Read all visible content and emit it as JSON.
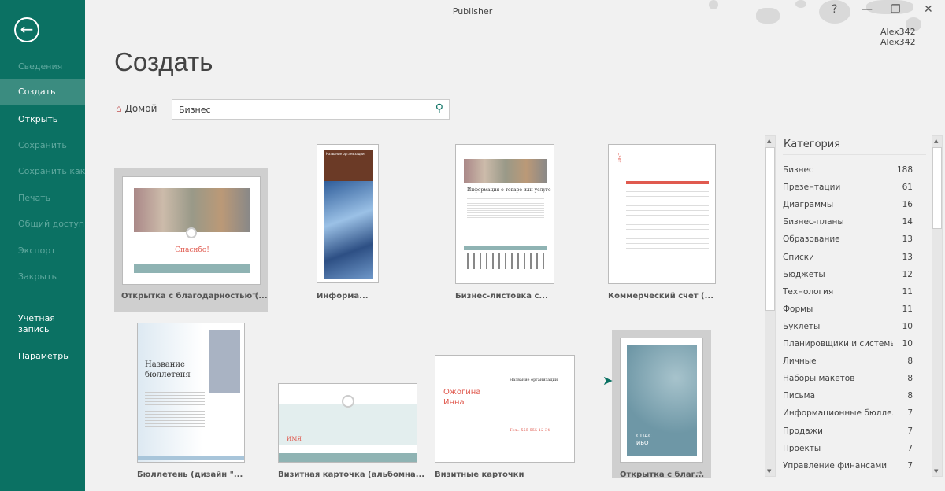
{
  "app": {
    "title": "Publisher",
    "help": "?",
    "user": "Alex342 Alex342"
  },
  "sidebar": {
    "items": [
      {
        "label": "Сведения",
        "enabled": false
      },
      {
        "label": "Создать",
        "enabled": true,
        "selected": true
      },
      {
        "label": "Открыть",
        "enabled": true
      },
      {
        "label": "Сохранить",
        "enabled": false
      },
      {
        "label": "Сохранить как",
        "enabled": false
      },
      {
        "label": "Печать",
        "enabled": false
      },
      {
        "label": "Общий доступ",
        "enabled": false
      },
      {
        "label": "Экспорт",
        "enabled": false
      },
      {
        "label": "Закрыть",
        "enabled": false
      },
      {
        "label": "Учетная запись",
        "enabled": true
      },
      {
        "label": "Параметры",
        "enabled": true
      }
    ]
  },
  "main": {
    "title": "Создать",
    "home": "Домой",
    "search_value": "Бизнес",
    "templates": [
      {
        "label": "Открытка с благодарностью (...",
        "thumb_text": "Спасибо!"
      },
      {
        "label": "Информа...",
        "thumb_text": "Название организации"
      },
      {
        "label": "Бизнес-листовка с...",
        "thumb_text": "Информация о товаре или услуге"
      },
      {
        "label": "Коммерческий счет (...",
        "thumb_text": "Счет"
      },
      {
        "label": "Бюллетень (дизайн \"...",
        "thumb_text": "Название бюллетеня"
      },
      {
        "label": "Визитная карточка (альбомна...",
        "thumb_text": "ИМЯ"
      },
      {
        "label": "Визитные карточки",
        "thumb_text": "Ожогина Инна",
        "thumb_text2": "Название организации",
        "thumb_text3": "Тел.: 555-555-12-34"
      },
      {
        "label": "Открытка с благ...",
        "thumb_text": "СПАС ИБО"
      }
    ]
  },
  "categories": {
    "heading": "Категория",
    "items": [
      {
        "name": "Бизнес",
        "count": "188"
      },
      {
        "name": "Презентации",
        "count": "61"
      },
      {
        "name": "Диаграммы",
        "count": "16"
      },
      {
        "name": "Бизнес-планы",
        "count": "14"
      },
      {
        "name": "Образование",
        "count": "13"
      },
      {
        "name": "Списки",
        "count": "13"
      },
      {
        "name": "Бюджеты",
        "count": "12"
      },
      {
        "name": "Технология",
        "count": "11"
      },
      {
        "name": "Формы",
        "count": "11"
      },
      {
        "name": "Буклеты",
        "count": "10"
      },
      {
        "name": "Планировщики и системы...",
        "count": "10"
      },
      {
        "name": "Личные",
        "count": "8"
      },
      {
        "name": "Наборы макетов",
        "count": "8"
      },
      {
        "name": "Письма",
        "count": "8"
      },
      {
        "name": "Информационные бюлле...",
        "count": "7"
      },
      {
        "name": "Продажи",
        "count": "7"
      },
      {
        "name": "Проекты",
        "count": "7"
      },
      {
        "name": "Управление финансами",
        "count": "7"
      }
    ]
  },
  "colors": {
    "sidebar": "#0b7163",
    "selected": "#3b8c80",
    "accent": "#e05a4f"
  }
}
